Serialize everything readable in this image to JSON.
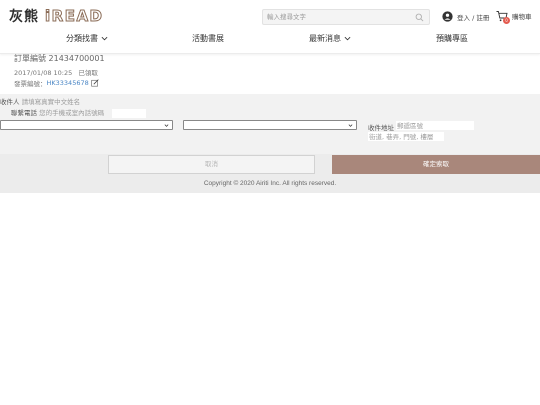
{
  "header": {
    "logo_cn": "灰熊",
    "logo_en": "iREAD",
    "search": {
      "placeholder": "輸入搜尋文字"
    },
    "login_label": "登入 / 註冊",
    "cart_label": "購物車",
    "cart_count": "0",
    "nav": [
      {
        "label": "分類找書"
      },
      {
        "label": "活動書展"
      },
      {
        "label": "最新消息"
      },
      {
        "label": "預購專區"
      }
    ]
  },
  "order": {
    "number": "訂單編號 21434700001",
    "datetime": "2017/01/08 10:25",
    "status": "已領取",
    "invoice_label": "發票編號：",
    "invoice_no": "HK33345678"
  },
  "form": {
    "recipient_label": "收件人",
    "recipient_placeholder": "請填寫真實中文姓名",
    "phone_label": "聯繫電話",
    "phone_placeholder": "您的手機或室內話號碼",
    "address_label": "收件地址",
    "zip_placeholder": "郵遞區號",
    "street_placeholder": "街道, 巷弄, 門號, 樓層"
  },
  "actions": {
    "cancel_label": "取消",
    "confirm_label": "確定索取"
  },
  "footer": {
    "copyright": "Copyright © 2020 Airiti Inc. All rights reserved."
  },
  "colors": {
    "accent": "#a9877b",
    "link": "#4a86c5",
    "badge": "#e45b4f"
  }
}
